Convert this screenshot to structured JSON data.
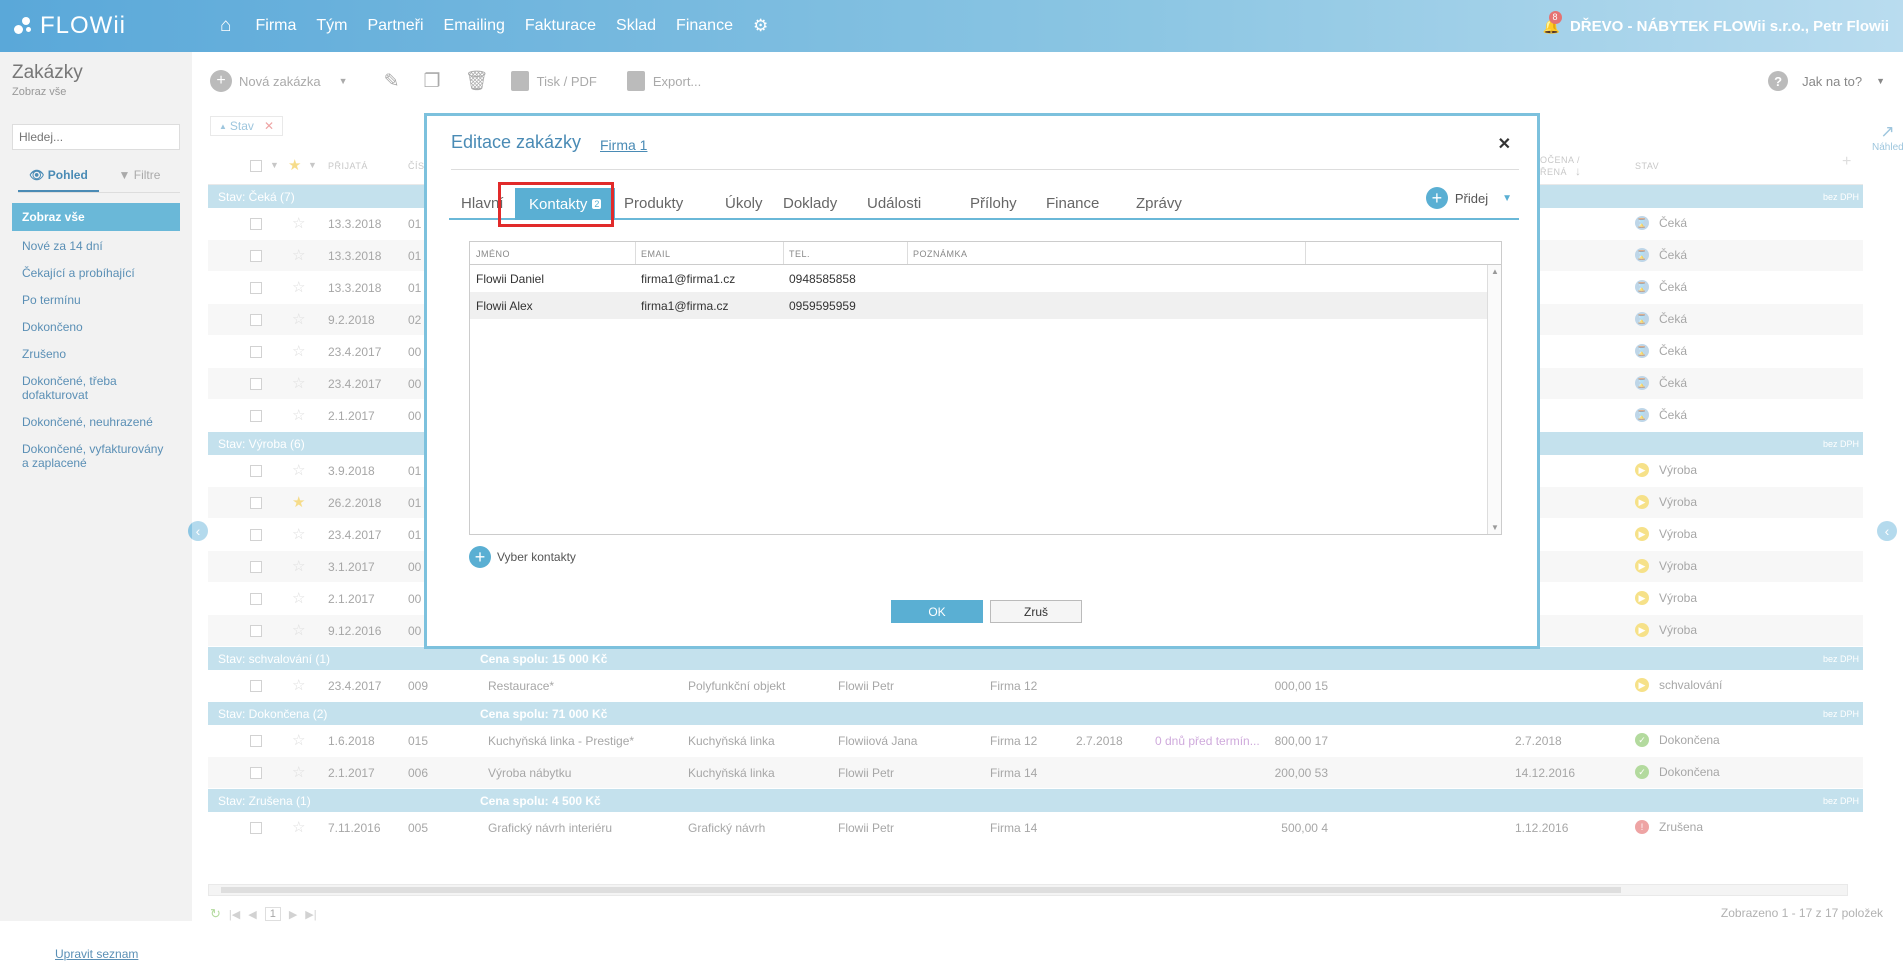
{
  "topbar": {
    "logo_text": "FLOWii",
    "nav": [
      "Firma",
      "Tým",
      "Partneři",
      "Emailing",
      "Fakturace",
      "Sklad",
      "Finance"
    ],
    "notification_count": "8",
    "company": "DŘEVO - NÁBYTEK FLOWii s.r.o., Petr Flowii"
  },
  "left": {
    "title": "Zakázky",
    "subtitle": "Zobraz vše",
    "search_placeholder": "Hledej...",
    "tabs": [
      "Pohled",
      "Filtre"
    ],
    "menu": [
      "Zobraz vše",
      "Nové za 14 dní",
      "Čekající a probíhající",
      "Po termínu",
      "Dokončeno",
      "Zrušeno",
      "Dokončené, třeba dofakturovat",
      "Dokončené, neuhrazené",
      "Dokončené, vyfakturovány a zaplacené"
    ],
    "edit_list": "Upravit seznam"
  },
  "toolbar": {
    "new_order": "Nová zakázka",
    "print": "Tisk / PDF",
    "export": "Export...",
    "help": "Jak na to?"
  },
  "filter": {
    "label": "Stav"
  },
  "grid": {
    "headers": {
      "accepted": "PŘIJATÁ",
      "number": "ČÍS",
      "finished1": "OČENA /",
      "finished2": "ŘENÁ",
      "state": "STAV"
    },
    "groups": [
      {
        "title": "Stav: Čeká (7)",
        "sum": "",
        "bez": "bez DPH",
        "rows": [
          {
            "date": "13.3.2018",
            "num": "01",
            "name": "",
            "type": "",
            "person": "",
            "firm": "",
            "d2": "",
            "note": "",
            "price": "",
            "d3": "",
            "state": "Čeká",
            "icon": "wait",
            "star": false
          },
          {
            "date": "13.3.2018",
            "num": "01",
            "name": "",
            "type": "",
            "person": "",
            "firm": "",
            "d2": "",
            "note": "",
            "price": "",
            "d3": "",
            "state": "Čeká",
            "icon": "wait",
            "star": false
          },
          {
            "date": "13.3.2018",
            "num": "01",
            "name": "",
            "type": "",
            "person": "",
            "firm": "",
            "d2": "",
            "note": "",
            "price": "",
            "d3": "",
            "state": "Čeká",
            "icon": "wait",
            "star": false
          },
          {
            "date": "9.2.2018",
            "num": "02",
            "name": "",
            "type": "",
            "person": "",
            "firm": "",
            "d2": "",
            "note": "",
            "price": "",
            "d3": "",
            "state": "Čeká",
            "icon": "wait",
            "star": false
          },
          {
            "date": "23.4.2017",
            "num": "00",
            "name": "",
            "type": "",
            "person": "",
            "firm": "",
            "d2": "",
            "note": "",
            "price": "",
            "d3": "",
            "state": "Čeká",
            "icon": "wait",
            "star": false
          },
          {
            "date": "23.4.2017",
            "num": "00",
            "name": "",
            "type": "",
            "person": "",
            "firm": "",
            "d2": "",
            "note": "",
            "price": "",
            "d3": "",
            "state": "Čeká",
            "icon": "wait",
            "star": false
          },
          {
            "date": "2.1.2017",
            "num": "00",
            "name": "",
            "type": "",
            "person": "",
            "firm": "",
            "d2": "",
            "note": "",
            "price": "",
            "d3": "",
            "state": "Čeká",
            "icon": "wait",
            "star": false
          }
        ]
      },
      {
        "title": "Stav: Výroba (6)",
        "sum": "",
        "bez": "bez DPH",
        "rows": [
          {
            "date": "3.9.2018",
            "num": "01",
            "name": "",
            "type": "",
            "person": "",
            "firm": "",
            "d2": "",
            "note": "",
            "price": "",
            "d3": "",
            "state": "Výroba",
            "icon": "prod",
            "star": false
          },
          {
            "date": "26.2.2018",
            "num": "01",
            "name": "",
            "type": "",
            "person": "",
            "firm": "",
            "d2": "",
            "note": "",
            "price": "",
            "d3": "",
            "state": "Výroba",
            "icon": "prod",
            "star": true
          },
          {
            "date": "23.4.2017",
            "num": "01",
            "name": "",
            "type": "",
            "person": "",
            "firm": "",
            "d2": "",
            "note": "",
            "price": "",
            "d3": "",
            "state": "Výroba",
            "icon": "prod",
            "star": false
          },
          {
            "date": "3.1.2017",
            "num": "00",
            "name": "",
            "type": "",
            "person": "",
            "firm": "",
            "d2": "",
            "note": "",
            "price": "",
            "d3": "",
            "state": "Výroba",
            "icon": "prod",
            "star": false
          },
          {
            "date": "2.1.2017",
            "num": "00",
            "name": "",
            "type": "",
            "person": "",
            "firm": "",
            "d2": "",
            "note": "",
            "price": "",
            "d3": "",
            "state": "Výroba",
            "icon": "prod",
            "star": false
          },
          {
            "date": "9.12.2016",
            "num": "00",
            "name": "",
            "type": "",
            "person": "",
            "firm": "",
            "d2": "",
            "note": "",
            "price": "",
            "d3": "",
            "state": "Výroba",
            "icon": "prod",
            "star": false
          }
        ]
      },
      {
        "title": "Stav: schvalování (1)",
        "sum": "Cena spolu: 15 000 Kč",
        "bez": "bez DPH",
        "rows": [
          {
            "date": "23.4.2017",
            "num": "009",
            "name": "Restaurace*",
            "type": "Polyfunkční objekt",
            "person": "Flowii Petr",
            "firm": "Firma 12",
            "d2": "",
            "note": "",
            "price": "15 000,00",
            "d3": "",
            "state": "schvalování",
            "icon": "prod",
            "star": false
          }
        ]
      },
      {
        "title": "Stav: Dokončena (2)",
        "sum": "Cena spolu: 71 000 Kč",
        "bez": "bez DPH",
        "rows": [
          {
            "date": "1.6.2018",
            "num": "015",
            "name": "Kuchyňská linka - Prestige*",
            "type": "Kuchyňská linka",
            "person": "Flowiiová Jana",
            "firm": "Firma 12",
            "d2": "2.7.2018",
            "note": "0 dnů před termín...",
            "price": "17 800,00",
            "d3": "2.7.2018",
            "state": "Dokončena",
            "icon": "done",
            "star": false
          },
          {
            "date": "2.1.2017",
            "num": "006",
            "name": "Výroba nábytku",
            "type": "Kuchyňská linka",
            "person": "Flowii Petr",
            "firm": "Firma 14",
            "d2": "",
            "note": "",
            "price": "53 200,00",
            "d3": "14.12.2016",
            "state": "Dokončena",
            "icon": "done",
            "star": false
          }
        ]
      },
      {
        "title": "Stav: Zrušena (1)",
        "sum": "Cena spolu: 4 500 Kč",
        "bez": "bez DPH",
        "rows": [
          {
            "date": "7.11.2016",
            "num": "005",
            "name": "Grafický návrh interiéru",
            "type": "Grafický návrh",
            "person": "Flowii Petr",
            "firm": "Firma 14",
            "d2": "",
            "note": "",
            "price": "4 500,00",
            "d3": "1.12.2016",
            "state": "Zrušena",
            "icon": "cancel",
            "star": false
          }
        ]
      }
    ]
  },
  "pager": {
    "page": "1",
    "total": "Zobrazeno 1 - 17 z 17 položek"
  },
  "preview_label": "Náhled",
  "modal": {
    "title": "Editace zakázky",
    "link": "Firma 1",
    "tabs": [
      "Hlavní",
      "Kontakty",
      "Produkty",
      "Úkoly",
      "Doklady",
      "Události",
      "Přílohy",
      "Finance",
      "Zprávy"
    ],
    "contacts_badge": "2",
    "add_label": "Přidej",
    "columns": [
      "JMÉNO",
      "EMAIL",
      "TEL.",
      "POZNÁMKA"
    ],
    "contacts": [
      {
        "name": "Flowii Daniel",
        "email": "firma1@firma1.cz",
        "tel": "0948585858",
        "note": ""
      },
      {
        "name": "Flowii Alex",
        "email": "firma1@firma.cz",
        "tel": "0959595959",
        "note": ""
      }
    ],
    "select_contacts": "Vyber kontakty",
    "ok": "OK",
    "cancel": "Zruš"
  }
}
